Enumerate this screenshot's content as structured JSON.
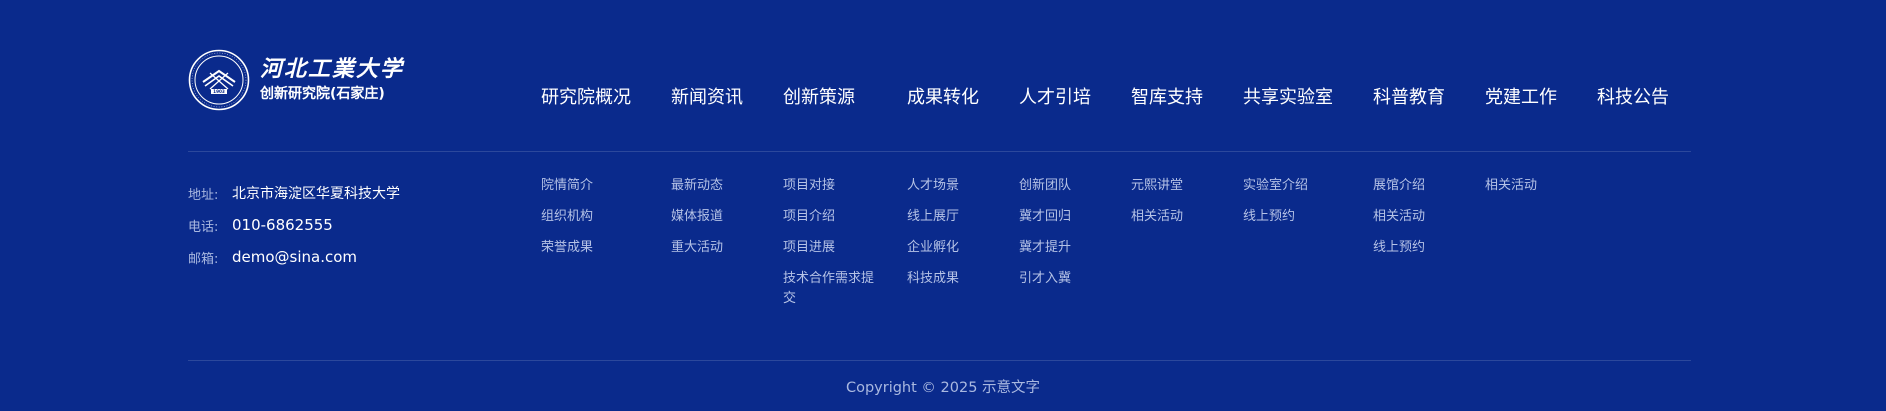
{
  "brand": {
    "name": "河北工業大学",
    "subtitle": "创新研究院(石家庄)",
    "seal_year": "1903"
  },
  "nav": [
    {
      "label": "研究院概况"
    },
    {
      "label": "新闻资讯"
    },
    {
      "label": "创新策源"
    },
    {
      "label": "成果转化"
    },
    {
      "label": "人才引培"
    },
    {
      "label": "智库支持"
    },
    {
      "label": "共享实验室"
    },
    {
      "label": "科普教育"
    },
    {
      "label": "党建工作"
    },
    {
      "label": "科技公告"
    }
  ],
  "contact": {
    "address_label": "地址:",
    "address": "北京市海淀区华夏科技大学",
    "phone_label": "电话:",
    "phone": "010-6862555",
    "email_label": "邮箱:",
    "email": "demo@sina.com"
  },
  "columns": [
    [
      "院情简介",
      "组织机构",
      "荣誉成果"
    ],
    [
      "最新动态",
      "媒体报道",
      "重大活动"
    ],
    [
      "项目对接",
      "项目介绍",
      "项目进展",
      "技术合作需求提交"
    ],
    [
      "人才场景",
      "线上展厅",
      "企业孵化",
      "科技成果"
    ],
    [
      "创新团队",
      "冀才回归",
      "冀才提升",
      "引才入冀"
    ],
    [
      "元熙讲堂",
      "相关活动"
    ],
    [
      "实验室介绍",
      "线上预约"
    ],
    [
      "展馆介绍",
      "相关活动",
      "线上预约"
    ],
    [
      "相关活动"
    ]
  ],
  "copyright": "Copyright © 2025 示意文字",
  "colors": {
    "background": "#0a2a8c",
    "text": "#ffffff",
    "muted_text": "#b5c2e6"
  },
  "icons": {
    "logo": "university-seal-icon"
  }
}
